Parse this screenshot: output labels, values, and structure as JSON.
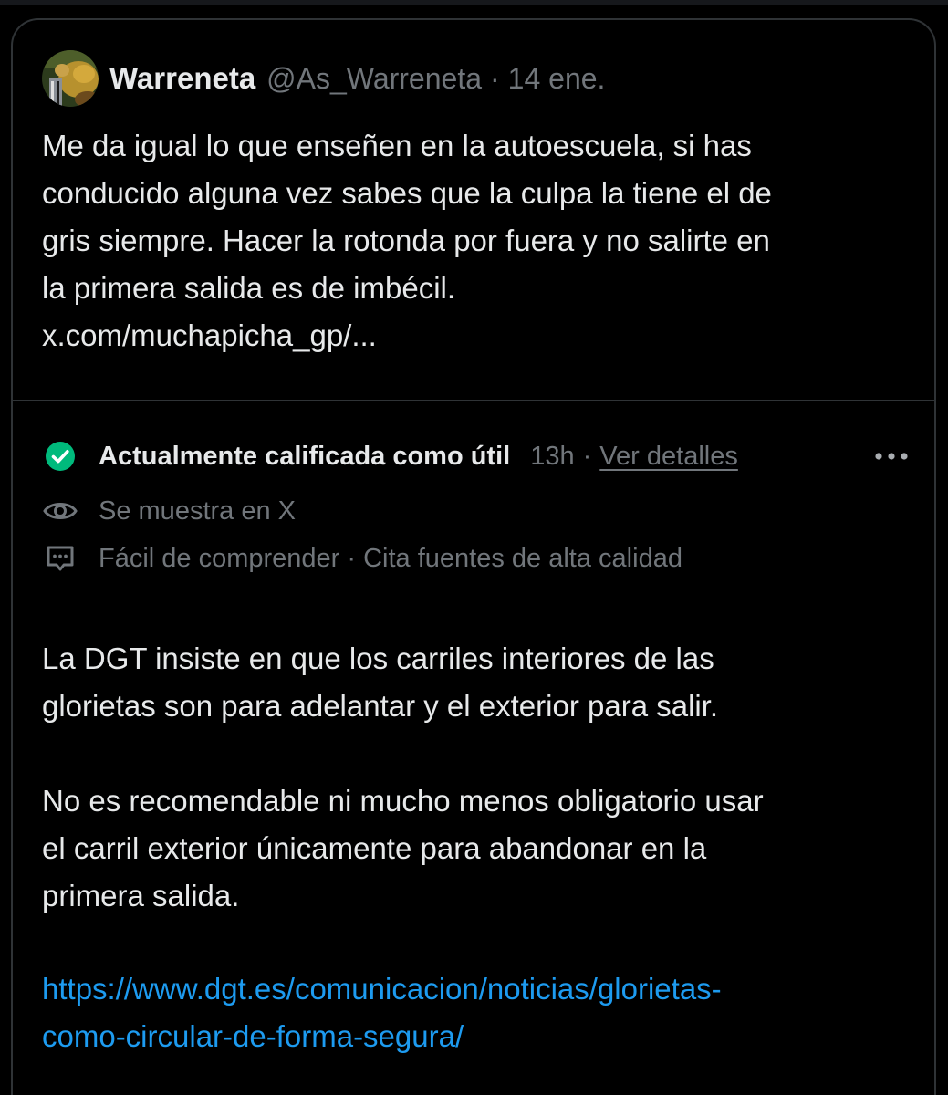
{
  "tweet": {
    "author_name": "Warreneta",
    "handle": "@As_Warreneta",
    "separator": "·",
    "date": "14 ene.",
    "text_lines": [
      "Me da igual lo que enseñen en la autoescuela, si has",
      "conducido alguna vez sabes que la culpa la tiene el de",
      "gris siempre. Hacer la rotonda por fuera y no salirte en",
      "la primera salida es de imbécil.",
      "x.com/muchapicha_gp/..."
    ]
  },
  "note": {
    "status": "Actualmente calificada como útil",
    "time": "13h",
    "separator": "·",
    "details_link": "Ver detalles",
    "shown_in": "Se muestra en X",
    "tags": "Fácil de comprender · Cita fuentes de alta calidad",
    "paragraph1_lines": [
      "La DGT insiste en que los carriles interiores de las",
      "glorietas son para adelantar y el exterior para salir."
    ],
    "paragraph2_lines": [
      "No es recomendable ni mucho menos obligatorio usar",
      "el carril exterior únicamente para abandonar en la",
      "primera salida."
    ],
    "link_lines": [
      "https://www.dgt.es/comunicacion/noticias/glorietas-",
      "como-circular-de-forma-segura/"
    ]
  },
  "icons": {
    "avatar": "avatar-image",
    "status": "check-circle-icon",
    "more": "more-horizontal-icon",
    "eye": "eye-icon",
    "feedback": "chat-bubble-icon"
  },
  "colors": {
    "background": "#000000",
    "text": "#e7e9ea",
    "secondary_text": "#71767b",
    "link": "#1d9bf0",
    "check": "#00ba7c",
    "border": "#2f3336"
  }
}
